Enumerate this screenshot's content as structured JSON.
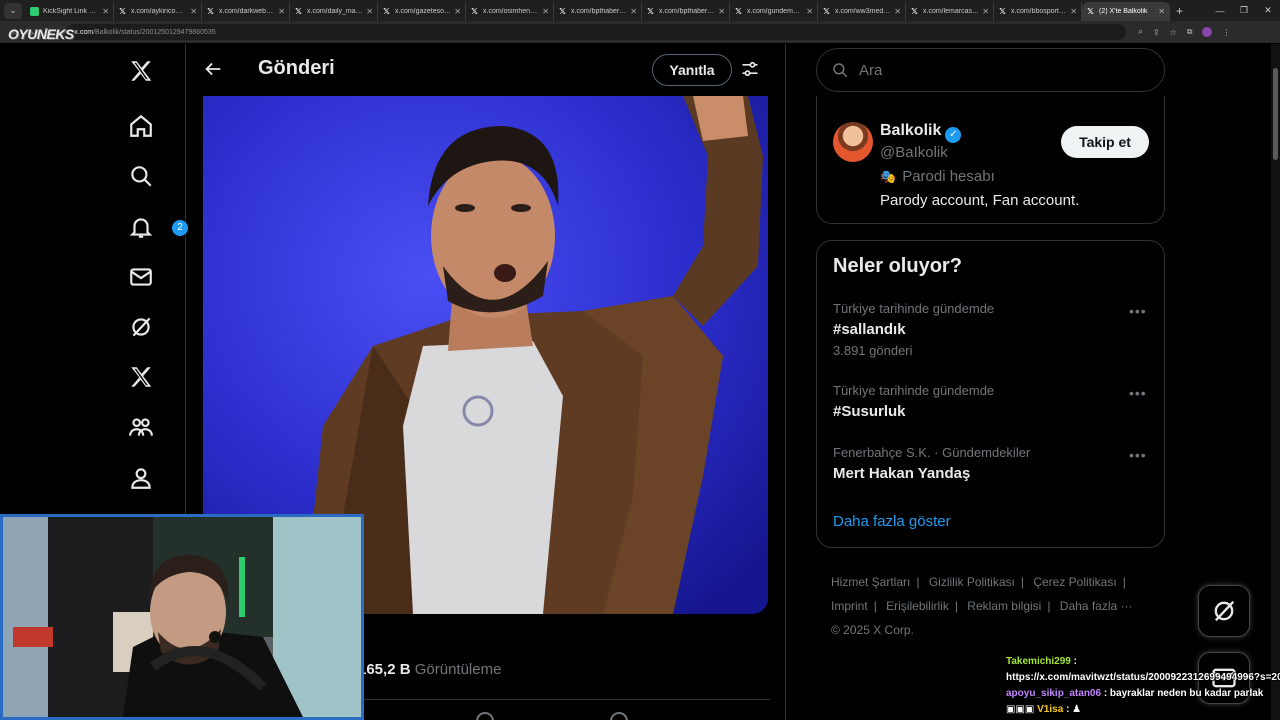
{
  "browser": {
    "tabs": [
      {
        "title": "KickSight Link Dete",
        "fav": "K",
        "active": false
      },
      {
        "title": "x.com/aykiricomtr/",
        "fav": "X",
        "active": false
      },
      {
        "title": "x.com/darkwebhab",
        "fav": "X",
        "active": false
      },
      {
        "title": "x.com/daily_magaz",
        "fav": "X",
        "active": false
      },
      {
        "title": "x.com/gazetesozcu",
        "fav": "X",
        "active": false
      },
      {
        "title": "x.com/osimhenkap",
        "fav": "X",
        "active": false
      },
      {
        "title": "x.com/bpthaber/sta",
        "fav": "X",
        "active": false
      },
      {
        "title": "x.com/bpthaber/sta",
        "fav": "X",
        "active": false
      },
      {
        "title": "x.com/gundemedair",
        "fav": "X",
        "active": false
      },
      {
        "title": "x.com/ww3mediau",
        "fav": "X",
        "active": false
      },
      {
        "title": "x.com/lemarcaspor",
        "fav": "X",
        "active": false
      },
      {
        "title": "x.com/bbosports/st",
        "fav": "X",
        "active": false
      },
      {
        "title": "(2) X'te Balkolik",
        "fav": "X",
        "active": true
      }
    ],
    "url_host": "x.com",
    "url_path": "/Balkolik/status/2001250129479860535",
    "stream_logo": "OYUNEKS"
  },
  "nav": {
    "notification_count": "2"
  },
  "main": {
    "title": "Gönderi",
    "reply_label": "Yanıtla",
    "views_count": "165,2 B",
    "views_label": "Görüntüleme"
  },
  "search": {
    "placeholder": "Ara"
  },
  "profile_card": {
    "name": "Balkolik",
    "handle": "@BaIkolik",
    "parody_label": "Parodi hesabı",
    "bio": "Parody account, Fan account.",
    "follow_label": "Takip et"
  },
  "trends": {
    "title": "Neler oluyor?",
    "items": [
      {
        "context": "Türkiye tarihinde gündemde",
        "name": "#sallandık",
        "count": "3.891 gönderi"
      },
      {
        "context": "Türkiye tarihinde gündemde",
        "name": "#Susurluk",
        "count": ""
      },
      {
        "context": "Fenerbahçe S.K. · Gündemdekiler",
        "name": "Mert Hakan Yandaş",
        "count": ""
      }
    ],
    "show_more": "Daha fazla göster"
  },
  "footer": {
    "links": [
      "Hizmet Şartları",
      "Gizlilik Politikası",
      "Çerez Politikası",
      "Imprint",
      "Erişilebilirlik",
      "Reklam bilgisi",
      "Daha fazla ···"
    ],
    "copyright": "© 2025 X Corp."
  },
  "chat": [
    {
      "user": "Takemichi299",
      "text": ":"
    },
    {
      "user": "",
      "text": "https://x.com/mavitwzt/status/2000922312699494996?s=20"
    },
    {
      "user": "apoyu_sikip_atan06",
      "text": ": bayraklar neden bu kadar parlak"
    },
    {
      "user": "V1isa",
      "text": ": ♟"
    }
  ],
  "colors": {
    "accent": "#1d9bf0",
    "background": "#000000",
    "border": "#2f3336",
    "muted_text": "#71767b"
  }
}
